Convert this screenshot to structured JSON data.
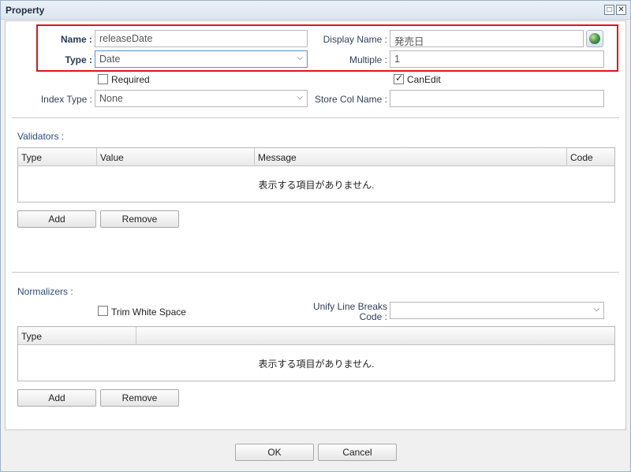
{
  "window": {
    "title": "Property",
    "maximize_icon": "□",
    "close_icon": "✕"
  },
  "form": {
    "name_label": "Name :",
    "name_value": "releaseDate",
    "display_name_label": "Display Name :",
    "display_name_value": "発売日",
    "type_label": "Type :",
    "type_value": "Date",
    "multiple_label": "Multiple :",
    "multiple_value": "1",
    "required_label": "Required",
    "required_checked": false,
    "canedit_label": "CanEdit",
    "canedit_checked": true,
    "index_type_label": "Index Type :",
    "index_type_value": "None",
    "store_col_label": "Store Col Name :",
    "store_col_value": ""
  },
  "validators": {
    "title": "Validators :",
    "columns": [
      "Type",
      "Value",
      "Message",
      "Code"
    ],
    "empty_text": "表示する項目がありません.",
    "add_label": "Add",
    "remove_label": "Remove"
  },
  "normalizers": {
    "title": "Normalizers :",
    "trim_label": "Trim White Space",
    "trim_checked": false,
    "unify_label_line1": "Unify Line Breaks",
    "unify_label_line2": "Code :",
    "unify_value": "",
    "columns": [
      "Type",
      ""
    ],
    "empty_text": "表示する項目がありません.",
    "add_label": "Add",
    "remove_label": "Remove"
  },
  "footer": {
    "ok_label": "OK",
    "cancel_label": "Cancel"
  },
  "colors": {
    "highlight": "#e0141b",
    "accent": "#2e4d7a"
  }
}
